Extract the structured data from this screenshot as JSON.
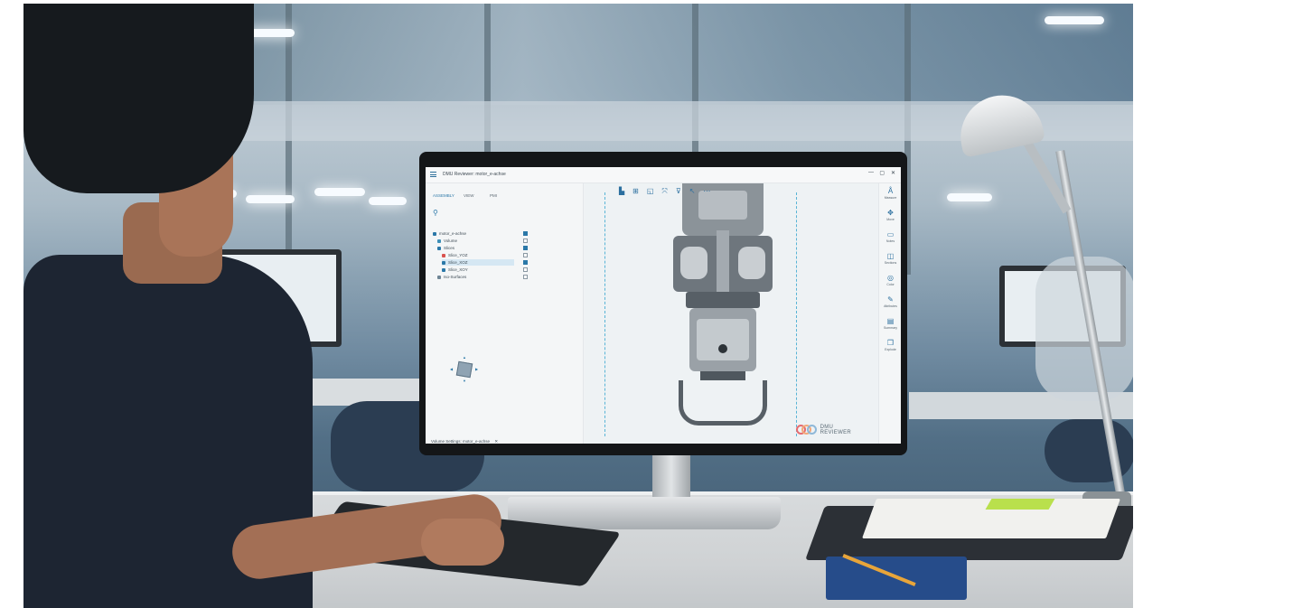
{
  "screen": {
    "window_title": "DMU Reviewer: motor_e-achse",
    "window_controls": [
      "—",
      "▢",
      "✕"
    ],
    "panel_tabs": [
      "ASSEMBLY",
      "VIEW",
      "PMI"
    ],
    "tree_items": [
      {
        "label": "motor_e-achse",
        "checked": true,
        "selected": false,
        "indent": 0
      },
      {
        "label": "Volume",
        "checked": false,
        "selected": false,
        "indent": 1
      },
      {
        "label": "Slices",
        "checked": true,
        "selected": false,
        "indent": 1
      },
      {
        "label": "Slice_YOZ",
        "checked": false,
        "selected": false,
        "indent": 2
      },
      {
        "label": "Slice_XOZ",
        "checked": true,
        "selected": true,
        "indent": 2
      },
      {
        "label": "Slice_XOY",
        "checked": false,
        "selected": false,
        "indent": 2
      },
      {
        "label": "Iso-Surfaces",
        "checked": false,
        "selected": false,
        "indent": 1
      }
    ],
    "breadcrumb": "Volume Settings: motor_e-achse",
    "tools": [
      {
        "icon": "measure-icon",
        "label": "Measure"
      },
      {
        "icon": "move-icon",
        "label": "Move"
      },
      {
        "icon": "notes-icon",
        "label": "Notes"
      },
      {
        "icon": "sections-icon",
        "label": "Sections"
      },
      {
        "icon": "color-icon",
        "label": "Color"
      },
      {
        "icon": "attributes-icon",
        "label": "Attributes"
      },
      {
        "icon": "summary-icon",
        "label": "Summary"
      },
      {
        "icon": "explode-icon",
        "label": "Explode"
      }
    ],
    "brand": {
      "line1": "DMU",
      "line2": "REVIEWER"
    },
    "accent_color": "#2b78a8",
    "guide_color": "#58b4d6"
  }
}
